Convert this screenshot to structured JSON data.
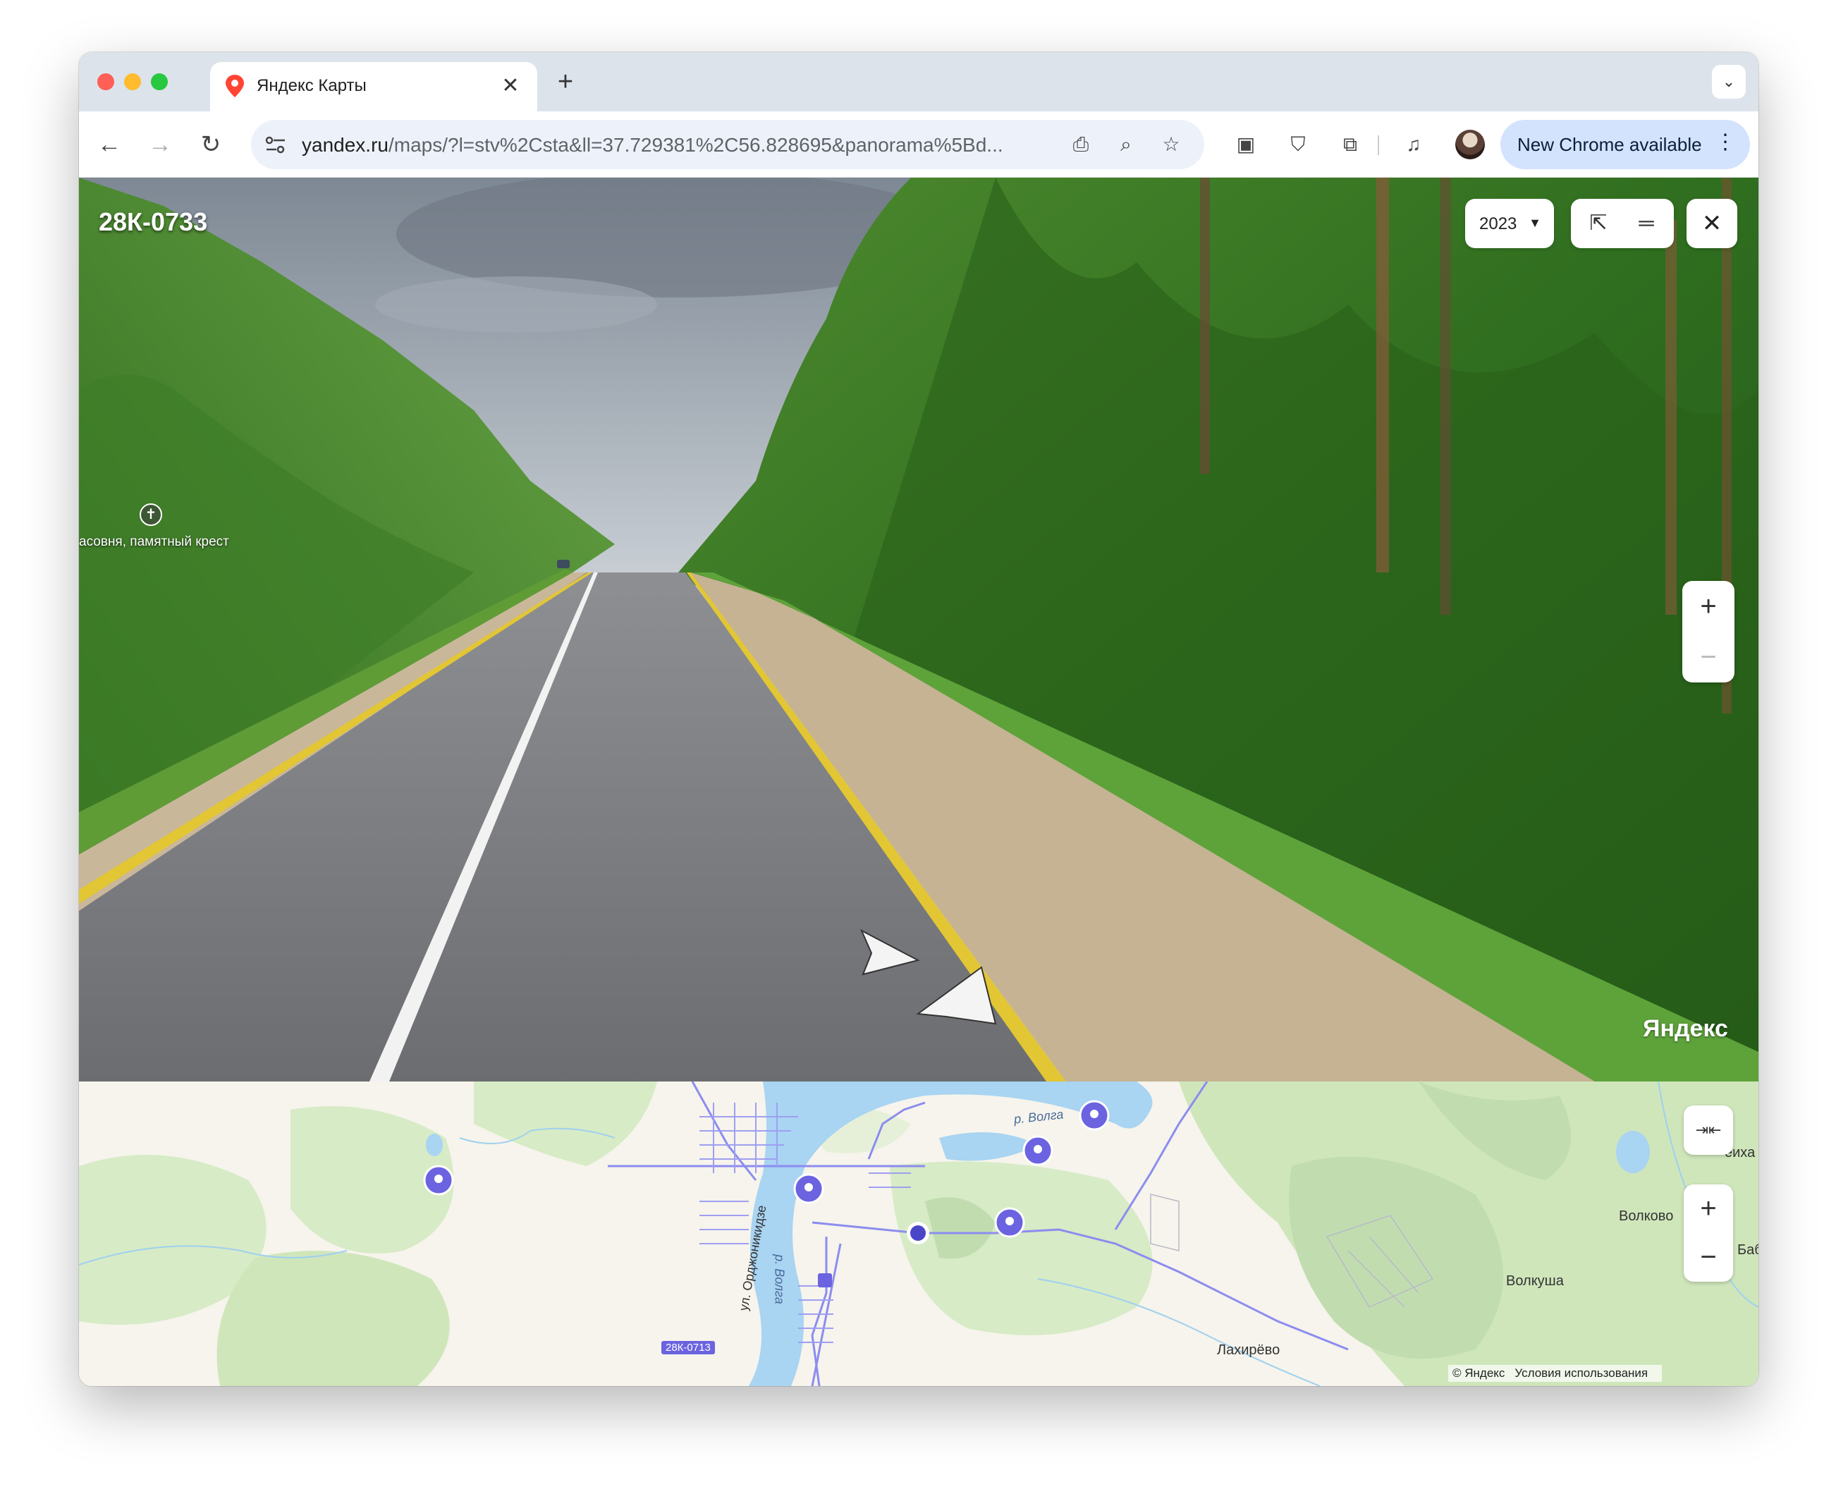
{
  "browser": {
    "tab_title": "Яндекс Карты",
    "url_host": "yandex.ru",
    "url_rest": "/maps/?l=stv%2Csta&ll=37.729381%2C56.828695&panorama%5Bd...",
    "update_label": "New Chrome available"
  },
  "panorama": {
    "road_label": "28К-0733",
    "poi_label": "асовня, памятный крест",
    "year": "2023",
    "watermark": "Яндекс"
  },
  "map": {
    "labels": {
      "volga_1": "р. Волга",
      "volga_2": "р. Волга",
      "street": "ул. Орджоникидзе",
      "volkovo": "Волково",
      "volkusha": "Волкуша",
      "lakhirevo": "Лахирёво",
      "seikha": "еиха",
      "bab": "Баб",
      "road_shield": "28К-0713"
    },
    "copyright": "© Яндекс",
    "terms": "Условия использования"
  },
  "colors": {
    "tabbar": "#dde3ea",
    "update_button": "#d3e3fd",
    "map_road": "#8c8cf0",
    "map_marker": "#6b63e0",
    "map_water": "#a9d4f2"
  }
}
